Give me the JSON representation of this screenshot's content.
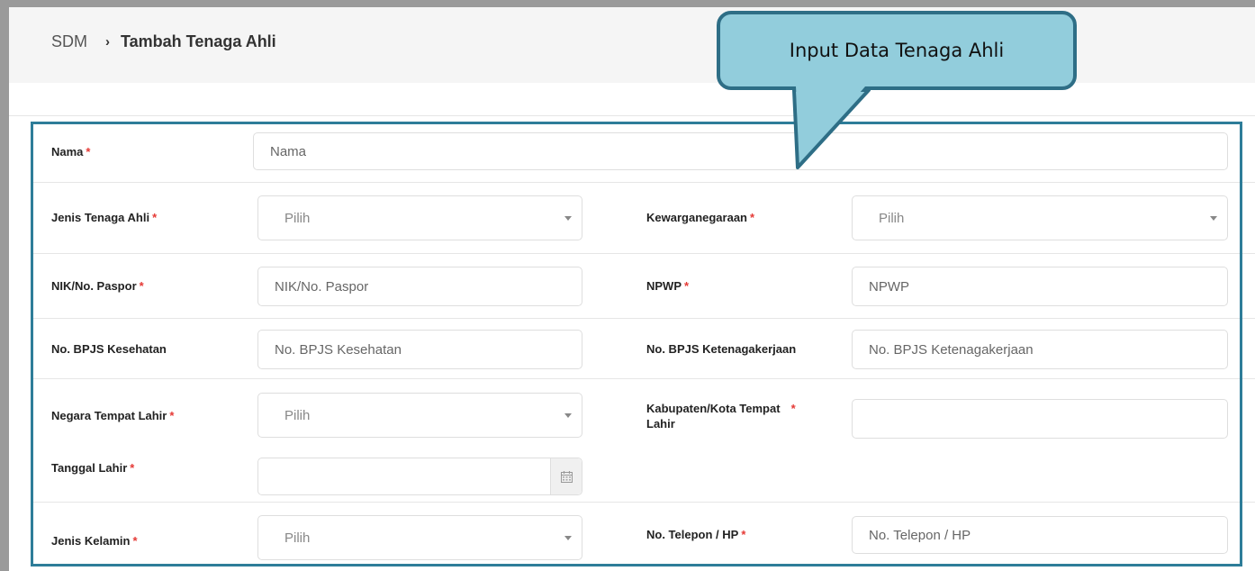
{
  "breadcrumb": {
    "root": "SDM",
    "separator": "›",
    "current": "Tambah Tenaga Ahli"
  },
  "callout": {
    "text": "Input Data Tenaga Ahli"
  },
  "required_mark": "*",
  "form": {
    "nama": {
      "label": "Nama",
      "placeholder": "Nama"
    },
    "jenis_tenaga_ahli": {
      "label": "Jenis Tenaga Ahli",
      "value": "Pilih"
    },
    "kewarganegaraan": {
      "label": "Kewarganegaraan",
      "value": "Pilih"
    },
    "nik": {
      "label": "NIK/No. Paspor",
      "placeholder": "NIK/No. Paspor"
    },
    "npwp": {
      "label": "NPWP",
      "placeholder": "NPWP"
    },
    "bpjs_kesehatan": {
      "label": "No. BPJS Kesehatan",
      "placeholder": "No. BPJS Kesehatan"
    },
    "bpjs_ketenagakerjaan": {
      "label": "No. BPJS Ketenagakerjaan",
      "placeholder": "No. BPJS Ketenagakerjaan"
    },
    "negara_tempat_lahir": {
      "label": "Negara Tempat Lahir",
      "value": "Pilih"
    },
    "kota_tempat_lahir": {
      "label_line1": "Kabupaten/Kota Tempat",
      "label_line2": "Lahir",
      "value": ""
    },
    "tanggal_lahir": {
      "label": "Tanggal Lahir",
      "value": ""
    },
    "jenis_kelamin": {
      "label": "Jenis Kelamin",
      "value": "Pilih"
    },
    "telepon": {
      "label": "No. Telepon / HP",
      "placeholder": "No. Telepon / HP"
    }
  },
  "icons": {
    "calendar": "calendar-icon",
    "dropdown": "caret-down-icon"
  },
  "colors": {
    "callout_fill": "#92cddc",
    "callout_border": "#2e6e86",
    "frame_border": "#2e7d99",
    "required": "#e53935"
  }
}
